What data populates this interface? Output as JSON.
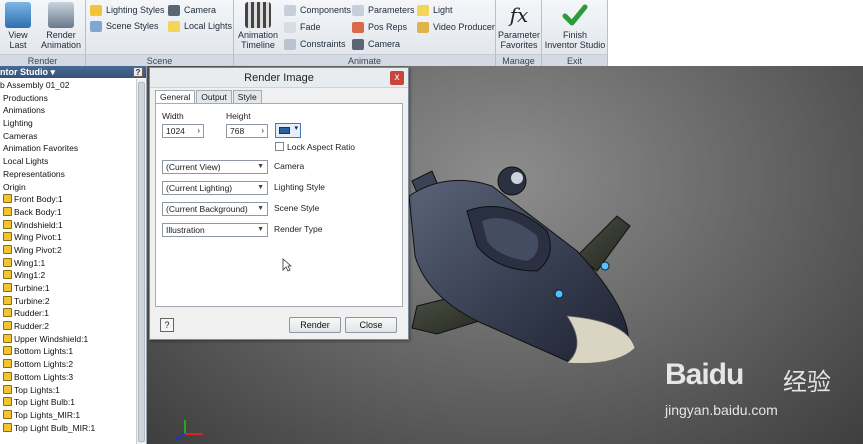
{
  "ribbon": {
    "render_panel": {
      "label": "Render",
      "buttons": [
        {
          "line1": "View",
          "line2": "Last"
        },
        {
          "line1": "Render",
          "line2": "Animation"
        }
      ]
    },
    "scene_panel": {
      "label": "Scene",
      "buttons": [
        "Lighting Styles",
        "Scene Styles",
        "Camera",
        "Local Lights"
      ]
    },
    "animate_panel": {
      "label": "Animate",
      "big": {
        "line1": "Animation",
        "line2": "Timeline"
      },
      "buttons": [
        "Components",
        "Fade",
        "Constraints",
        "Parameters",
        "Pos Reps",
        "Camera",
        "Light",
        "Video Producer"
      ]
    },
    "manage_panel": {
      "label": "Manage",
      "big": {
        "line1": "Parameter",
        "line2": "Favorites",
        "glyph": "fx"
      }
    },
    "exit_panel": {
      "label": "Exit",
      "big": {
        "line1": "Finish",
        "line2": "Inventor Studio"
      }
    }
  },
  "browser": {
    "title": "ntor Studio",
    "help": "?",
    "items": [
      "b Assembly 01_02",
      "Productions",
      "Animations",
      "Lighting",
      "Cameras",
      "Animation Favorites",
      "Local Lights",
      "Representations",
      "Origin",
      "Front Body:1",
      "Back Body:1",
      "Windshield:1",
      "Wing Pivot:1",
      "Wing Pivot:2",
      "Wing1:1",
      "Wing1:2",
      "Turbine:1",
      "Turbine:2",
      "Rudder:1",
      "Rudder:2",
      "Upper Windshield:1",
      "Bottom Lights:1",
      "Bottom Lights:2",
      "Bottom Lights:3",
      "Top Lights:1",
      "Top Light Bulb:1",
      "Top Lights_MIR:1",
      "Top Light Bulb_MIR:1"
    ]
  },
  "dialog": {
    "title": "Render Image",
    "close": "x",
    "tabs": [
      "General",
      "Output",
      "Style"
    ],
    "width_label": "Width",
    "width_value": "1024",
    "height_label": "Height",
    "height_value": "768",
    "lock_label": "Lock Aspect Ratio",
    "rows": [
      {
        "value": "(Current View)",
        "label": "Camera"
      },
      {
        "value": "(Current Lighting)",
        "label": "Lighting Style"
      },
      {
        "value": "(Current Background)",
        "label": "Scene Style"
      },
      {
        "value": "Illustration",
        "label": "Render Type"
      }
    ],
    "help": "?",
    "render_button": "Render",
    "close_button": "Close"
  },
  "watermark": {
    "brand": "Baidu",
    "cn": "经验",
    "url": "jingyan.baidu.com"
  }
}
